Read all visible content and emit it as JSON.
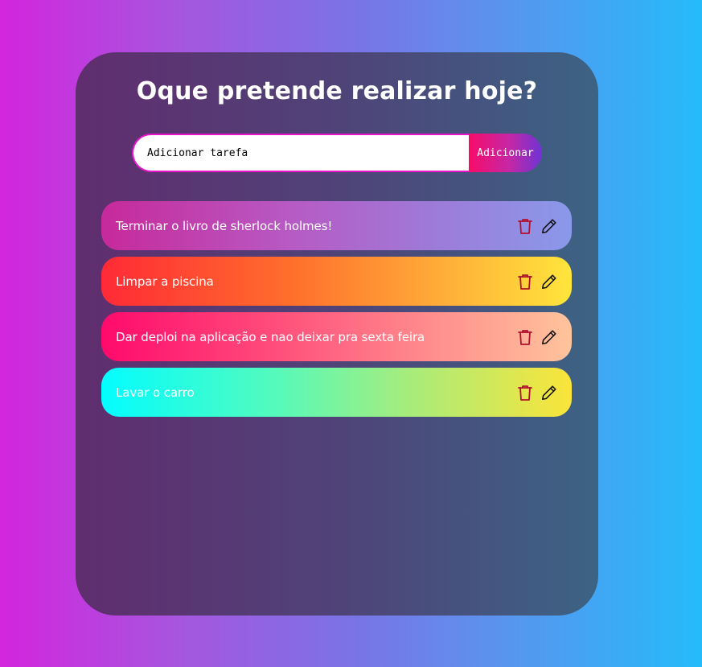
{
  "header": {
    "title": "Oque pretende realizar hoje?"
  },
  "form": {
    "input_placeholder": "Adicionar tarefa",
    "input_value": "",
    "add_label": "Adicionar"
  },
  "tasks": [
    {
      "text": "Terminar o livro de sherlock holmes!",
      "delete_icon": "trash-icon",
      "edit_icon": "pencil-icon"
    },
    {
      "text": "Limpar a piscina",
      "delete_icon": "trash-icon",
      "edit_icon": "pencil-icon"
    },
    {
      "text": "Dar deploi na aplicação e nao deixar pra sexta feira",
      "delete_icon": "trash-icon",
      "edit_icon": "pencil-icon"
    },
    {
      "text": "Lavar o carro",
      "delete_icon": "trash-icon",
      "edit_icon": "pencil-icon"
    }
  ],
  "colors": {
    "delete_icon": "#b0102d",
    "edit_icon": "#111111",
    "input_border": "#e815c8"
  }
}
